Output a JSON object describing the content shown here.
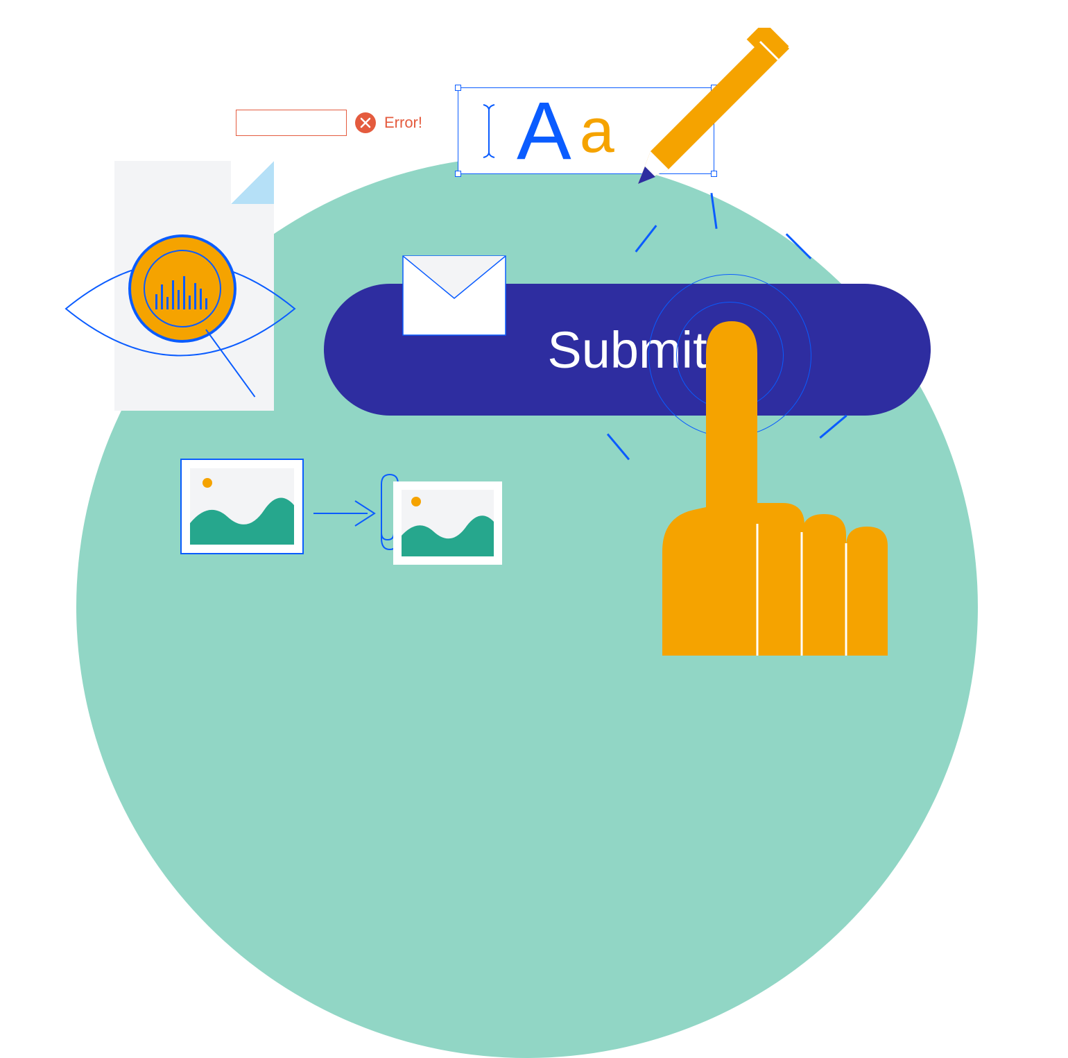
{
  "colors": {
    "teal": "#91d6c5",
    "blue": "#0a5cff",
    "indigo": "#2e2da0",
    "orange": "#f5a300",
    "red": "#e45b3e",
    "white": "#ffffff",
    "lightgray": "#f3f4f6",
    "skyblue": "#b5e0f7",
    "teal_dark": "#26a78d"
  },
  "error": {
    "label": "Error!"
  },
  "text_frame": {
    "letter_upper": "A",
    "letter_lower": "a"
  },
  "submit": {
    "label": "Submit"
  }
}
